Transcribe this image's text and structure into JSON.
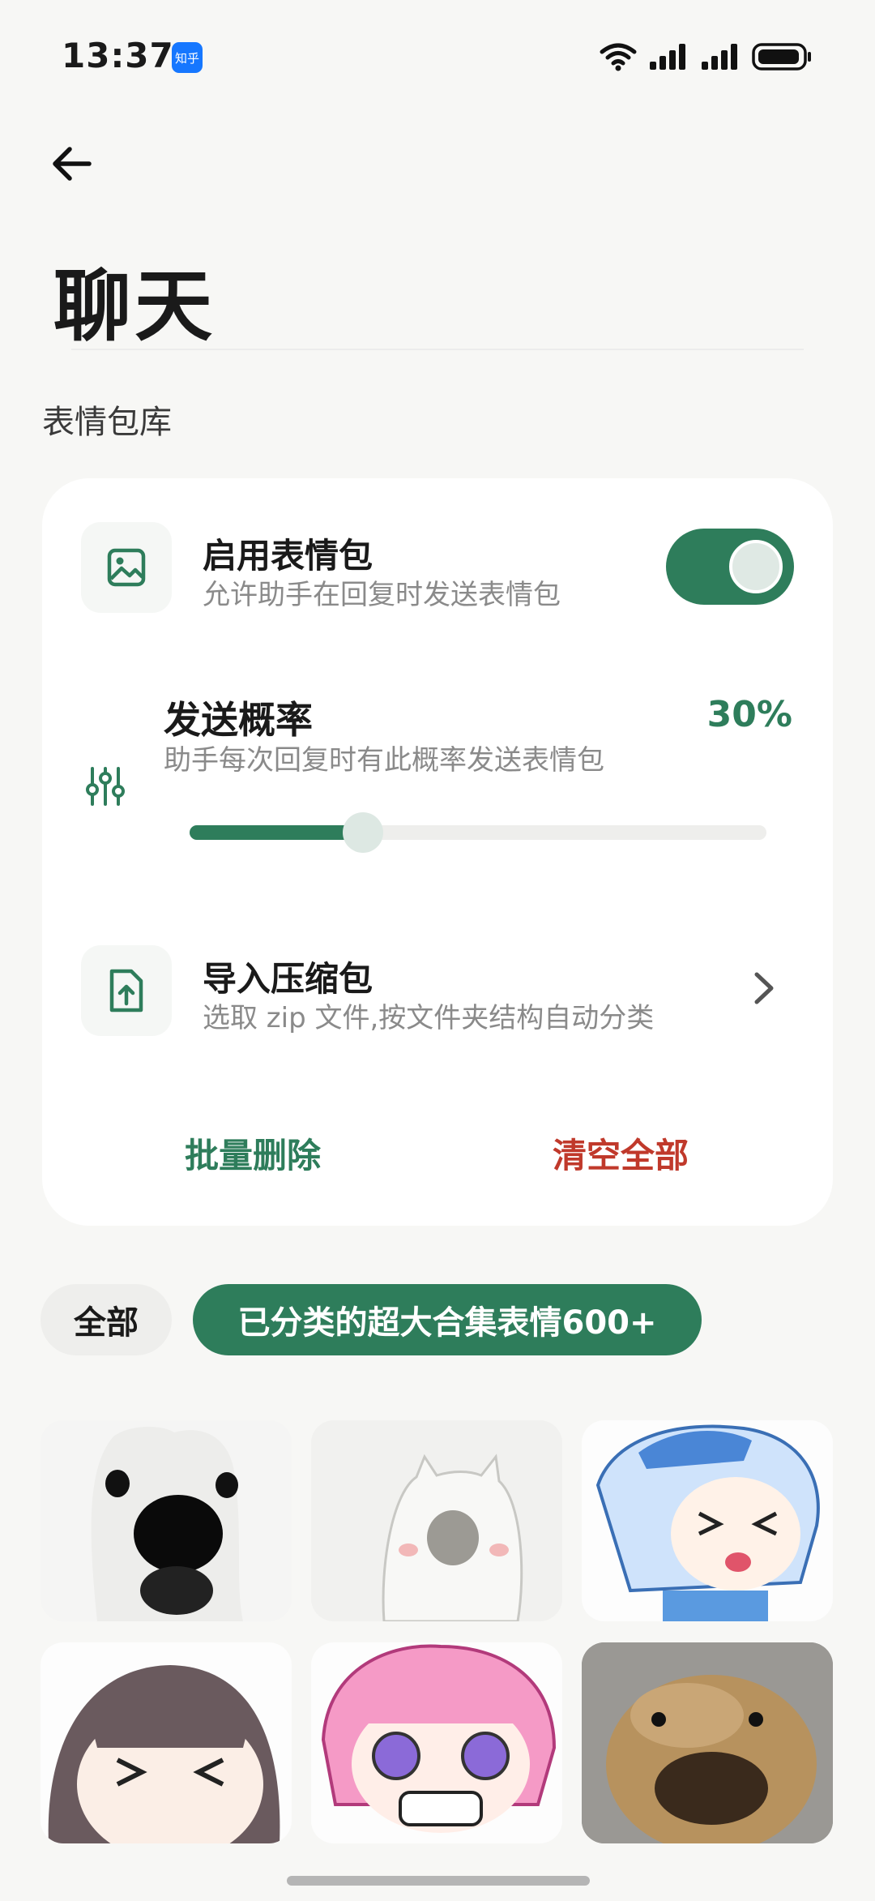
{
  "status_bar": {
    "time": "13:37",
    "app_badge": "知乎",
    "icons": [
      "wifi-icon",
      "signal-icon",
      "signal-icon",
      "battery-icon"
    ]
  },
  "header": {
    "back_icon": "back-arrow-icon",
    "title": "聊天"
  },
  "section": {
    "label": "表情包库"
  },
  "settings": {
    "enable": {
      "icon": "image-icon",
      "title": "启用表情包",
      "subtitle": "允许助手在回复时发送表情包",
      "enabled": true
    },
    "rate": {
      "icon": "sliders-icon",
      "title": "发送概率",
      "subtitle": "助手每次回复时有此概率发送表情包",
      "value_label": "30%",
      "value": 0.3
    },
    "import": {
      "icon": "upload-file-icon",
      "title": "导入压缩包",
      "subtitle": "选取 zip 文件,按文件夹结构自动分类"
    },
    "actions": {
      "batch_delete": "批量删除",
      "clear_all": "清空全部"
    }
  },
  "filters": {
    "chips": [
      {
        "label": "全部",
        "selected": false
      },
      {
        "label": "已分类的超大合集表情600+",
        "selected": true
      }
    ]
  },
  "stickers": [
    {
      "name": "dog-sticker"
    },
    {
      "name": "cat-meme-sticker"
    },
    {
      "name": "anime-girl-blue-sticker"
    },
    {
      "name": "anime-girl-brown-sticker"
    },
    {
      "name": "anime-girl-pink-sticker"
    },
    {
      "name": "hamster-sticker"
    }
  ],
  "colors": {
    "accent": "#2e7d5b",
    "danger": "#c0392b",
    "background": "#f7f7f5"
  }
}
